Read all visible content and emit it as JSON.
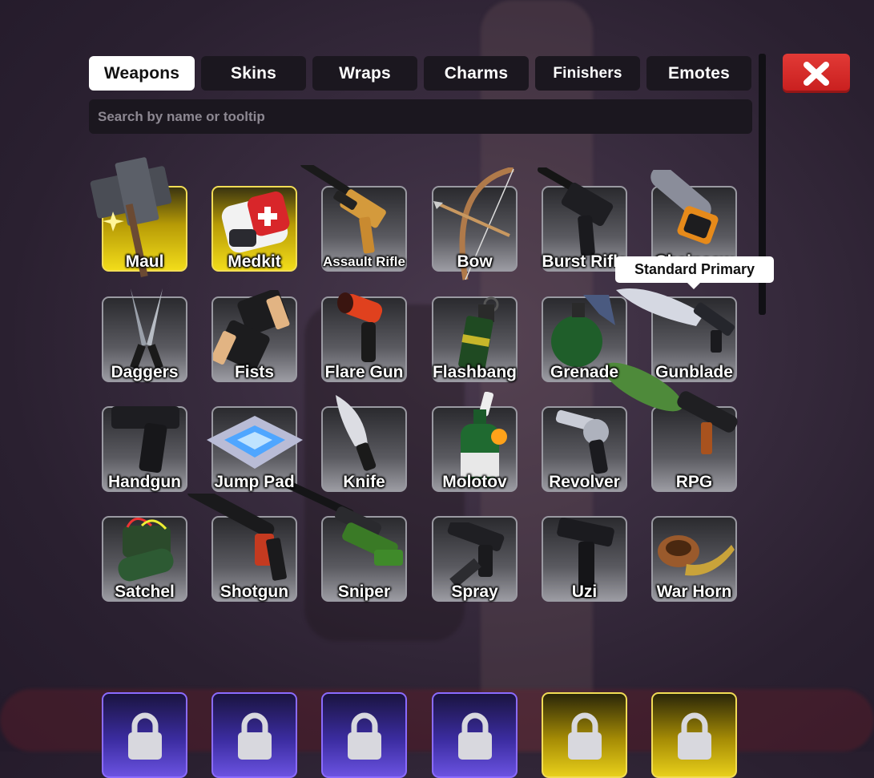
{
  "tabs": [
    {
      "label": "Weapons",
      "active": true
    },
    {
      "label": "Skins"
    },
    {
      "label": "Wraps"
    },
    {
      "label": "Charms"
    },
    {
      "label": "Finishers"
    },
    {
      "label": "Emotes"
    }
  ],
  "search": {
    "placeholder": "Search by name or tooltip",
    "value": ""
  },
  "tooltip": {
    "text": "Standard Primary"
  },
  "colors": {
    "accent_gold": "#f2dc1a",
    "close_red": "#d92a28",
    "locked_purple": "#6a52e0"
  },
  "grid": {
    "rows": [
      [
        {
          "label": "Maul",
          "icon": "maul-icon",
          "rarity": "gold"
        },
        {
          "label": "Medkit",
          "icon": "medkit-icon",
          "rarity": "gold"
        },
        {
          "label": "Assault Rifle",
          "icon": "assault-rifle-icon",
          "rarity": "standard"
        },
        {
          "label": "Bow",
          "icon": "bow-icon",
          "rarity": "standard"
        },
        {
          "label": "Burst Rifle",
          "icon": "burst-rifle-icon",
          "rarity": "standard"
        },
        {
          "label": "Chainsaw",
          "icon": "chainsaw-icon",
          "rarity": "standard"
        }
      ],
      [
        {
          "label": "Daggers",
          "icon": "daggers-icon",
          "rarity": "standard"
        },
        {
          "label": "Fists",
          "icon": "fists-icon",
          "rarity": "standard"
        },
        {
          "label": "Flare Gun",
          "icon": "flare-gun-icon",
          "rarity": "standard"
        },
        {
          "label": "Flashbang",
          "icon": "flashbang-icon",
          "rarity": "standard"
        },
        {
          "label": "Grenade",
          "icon": "grenade-icon",
          "rarity": "standard"
        },
        {
          "label": "Gunblade",
          "icon": "gunblade-icon",
          "rarity": "standard"
        }
      ],
      [
        {
          "label": "Handgun",
          "icon": "handgun-icon",
          "rarity": "standard"
        },
        {
          "label": "Jump Pad",
          "icon": "jump-pad-icon",
          "rarity": "standard"
        },
        {
          "label": "Knife",
          "icon": "knife-icon",
          "rarity": "standard"
        },
        {
          "label": "Molotov",
          "icon": "molotov-icon",
          "rarity": "standard"
        },
        {
          "label": "Revolver",
          "icon": "revolver-icon",
          "rarity": "standard"
        },
        {
          "label": "RPG",
          "icon": "rpg-icon",
          "rarity": "standard"
        }
      ],
      [
        {
          "label": "Satchel",
          "icon": "satchel-icon",
          "rarity": "standard"
        },
        {
          "label": "Shotgun",
          "icon": "shotgun-icon",
          "rarity": "standard"
        },
        {
          "label": "Sniper",
          "icon": "sniper-icon",
          "rarity": "standard"
        },
        {
          "label": "Spray",
          "icon": "spray-icon",
          "rarity": "standard"
        },
        {
          "label": "Uzi",
          "icon": "uzi-icon",
          "rarity": "standard"
        },
        {
          "label": "War Horn",
          "icon": "war-horn-icon",
          "rarity": "standard"
        }
      ]
    ],
    "locked_row": [
      {
        "icon": "lock-icon",
        "rarity": "purple"
      },
      {
        "icon": "lock-icon",
        "rarity": "purple"
      },
      {
        "icon": "lock-icon",
        "rarity": "purple"
      },
      {
        "icon": "lock-icon",
        "rarity": "purple"
      },
      {
        "icon": "lock-icon",
        "rarity": "gold"
      },
      {
        "icon": "lock-icon",
        "rarity": "gold"
      }
    ]
  }
}
